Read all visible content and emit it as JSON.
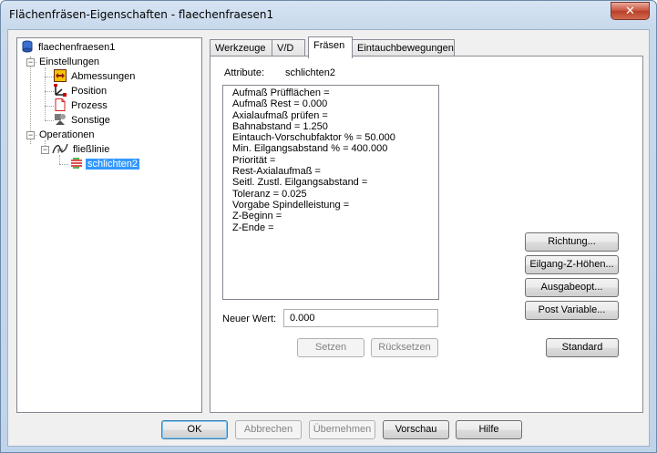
{
  "window": {
    "title": "Flächenfräsen-Eigenschaften - flaechenfraesen1",
    "close_glyph": "✕"
  },
  "tree": {
    "root": {
      "label": "flaechenfraesen1",
      "icon": "database-icon"
    },
    "settings": {
      "label": "Einstellungen",
      "expander": "−"
    },
    "settings_items": [
      {
        "label": "Abmessungen",
        "icon": "dimensions-icon"
      },
      {
        "label": "Position",
        "icon": "position-icon"
      },
      {
        "label": "Prozess",
        "icon": "process-icon"
      },
      {
        "label": "Sonstige",
        "icon": "misc-icon"
      }
    ],
    "operations": {
      "label": "Operationen",
      "expander": "−"
    },
    "flow": {
      "label": "fließlinie",
      "expander": "−",
      "icon": "flowline-icon"
    },
    "finish": {
      "label": "schlichten2",
      "icon": "finish-icon",
      "selected": true
    }
  },
  "tabs": [
    {
      "label": "Werkzeuge",
      "active": false
    },
    {
      "label": "V/D",
      "active": false
    },
    {
      "label": "Fräsen",
      "active": true
    },
    {
      "label": "Eintauchbewegungen",
      "active": false
    }
  ],
  "panel": {
    "attr_label": "Attribute:",
    "attr_value": "schlichten2",
    "attributes": [
      "Aufmaß Prüfflächen =",
      "Aufmaß Rest = 0.000",
      "Axialaufmaß prüfen =",
      "Bahnabstand = 1.250",
      "Eintauch-Vorschubfaktor % = 50.000",
      "Min. Eilgangsabstand % = 400.000",
      "Priorität =",
      "Rest-Axialaufmaß =",
      "Seitl. Zustl. Eilgangsabstand =",
      "Toleranz = 0.025",
      "Vorgabe Spindelleistung =",
      "Z-Beginn =",
      "Z-Ende ="
    ],
    "new_value_label": "Neuer Wert:",
    "new_value": "0.000",
    "set_label": "Setzen",
    "reset_label": "Rücksetzen",
    "direction_label": "Richtung...",
    "rapid_label": "Eilgang-Z-Höhen...",
    "output_label": "Ausgabeopt...",
    "postvar_label": "Post Variable...",
    "standard_label": "Standard"
  },
  "footer": {
    "ok": "OK",
    "cancel": "Abbrechen",
    "apply": "Übernehmen",
    "preview": "Vorschau",
    "help": "Hilfe"
  },
  "colors": {
    "selection": "#3399ff",
    "frame": "#bfd3ea",
    "close": "#c7503b"
  }
}
